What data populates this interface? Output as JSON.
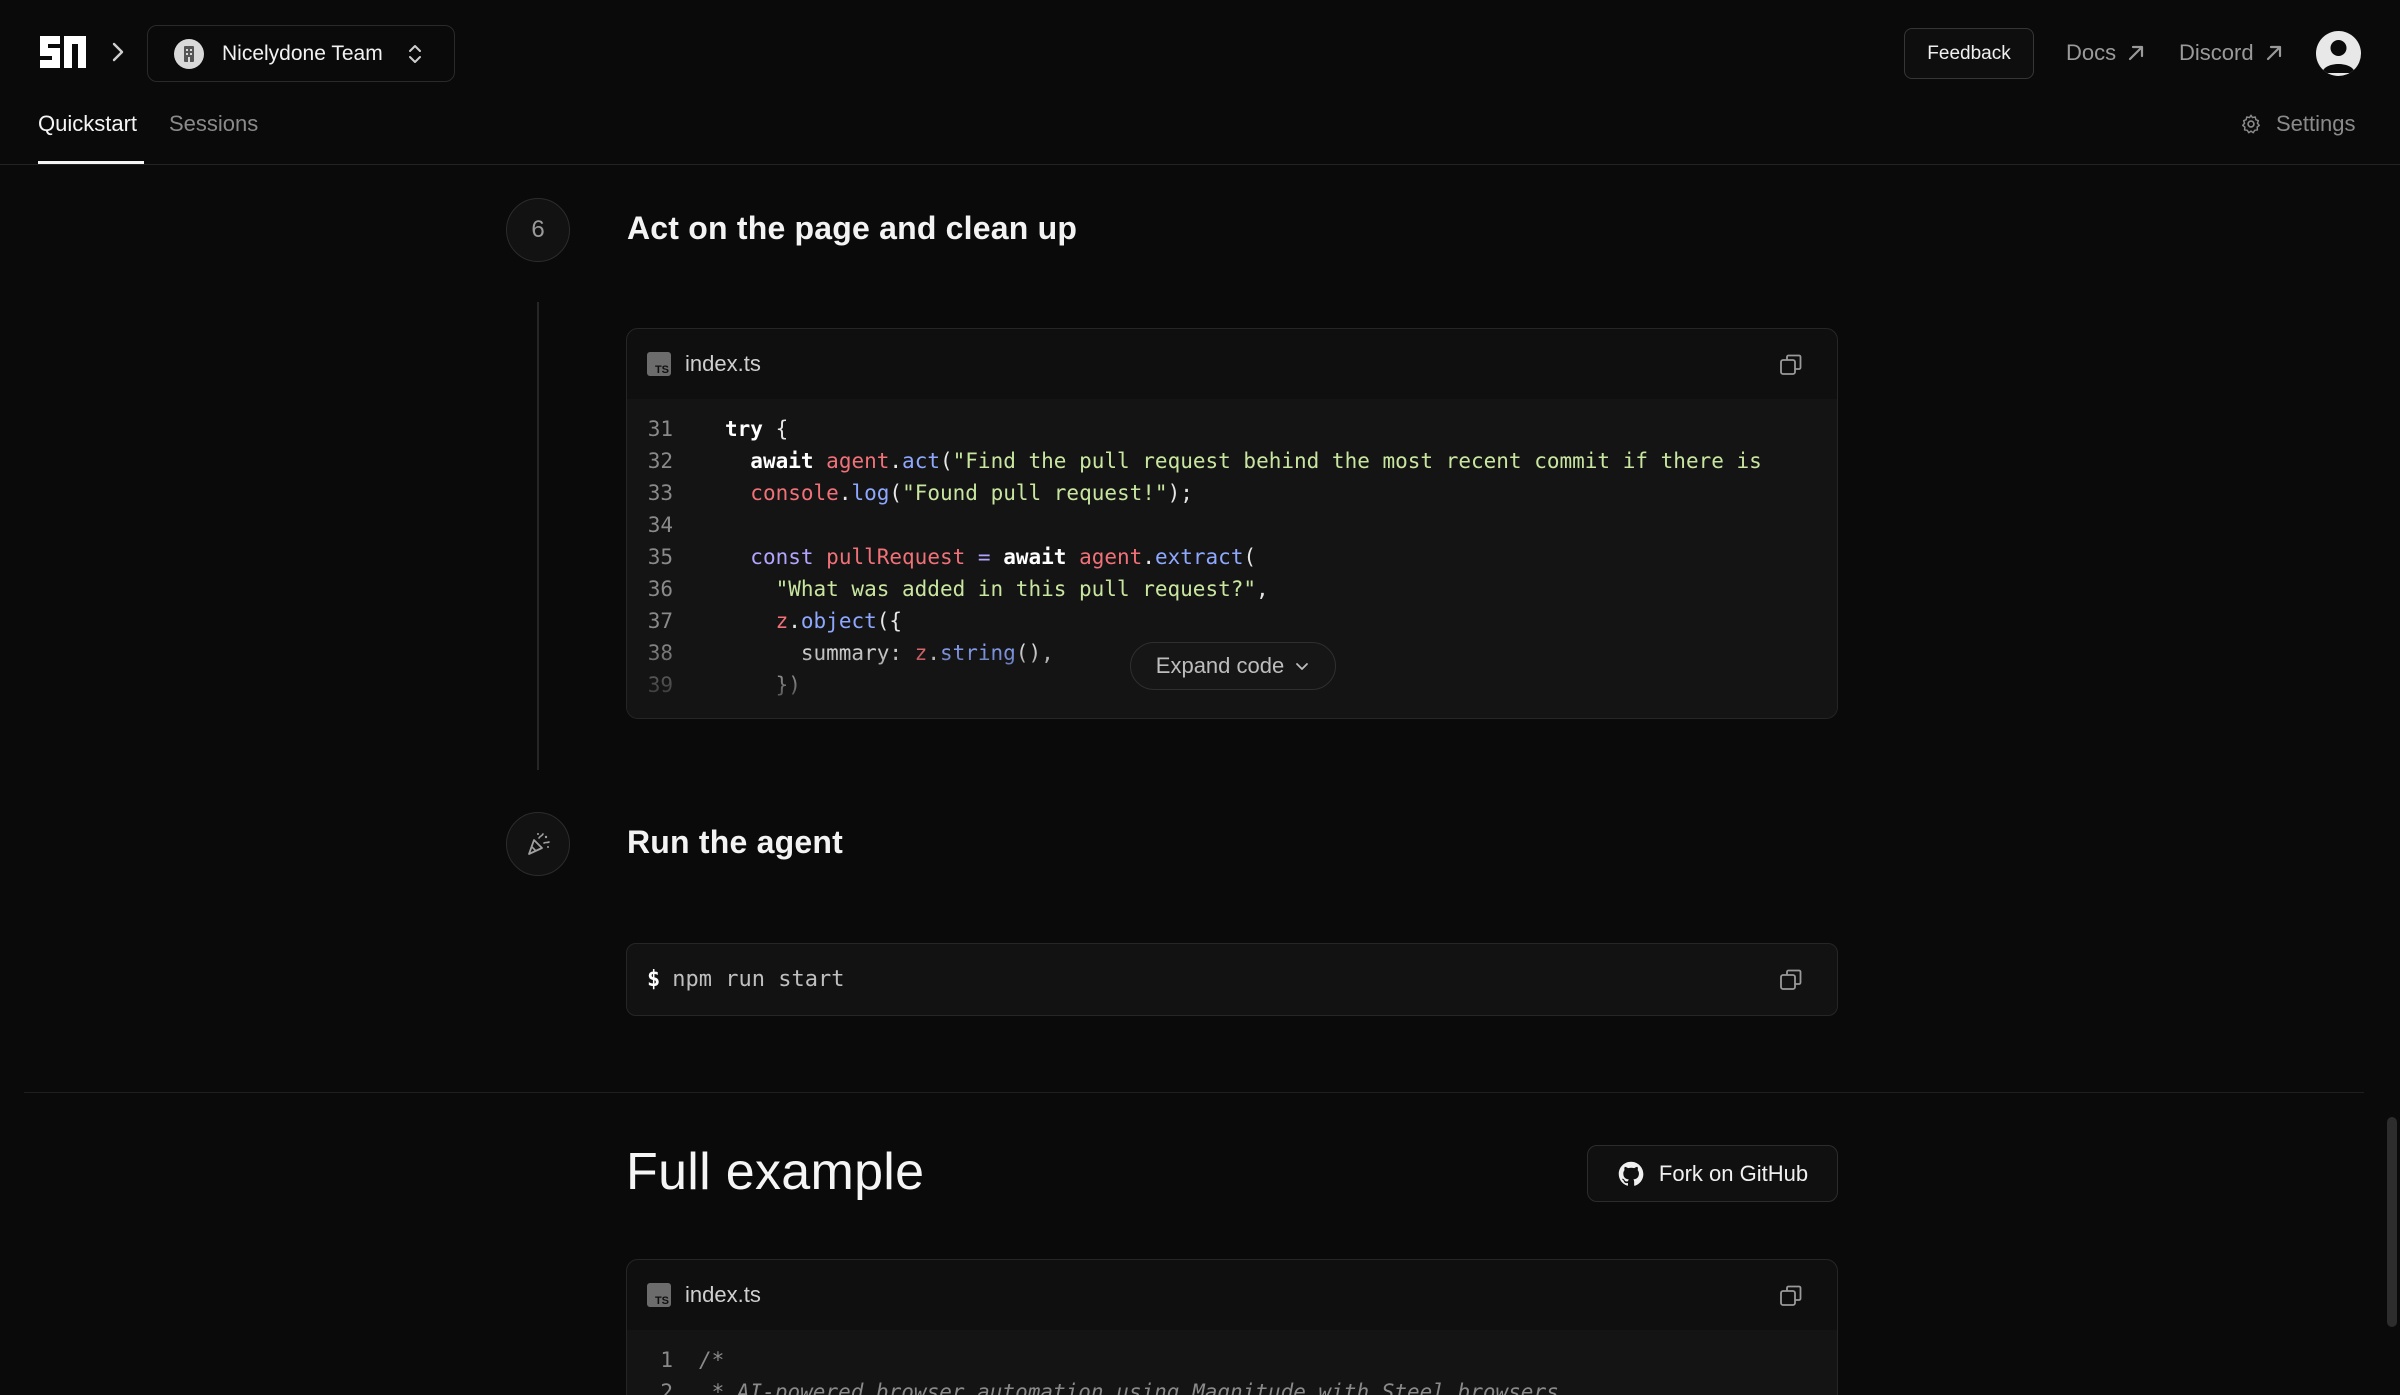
{
  "header": {
    "team_name": "Nicelydone Team",
    "feedback_label": "Feedback",
    "docs_label": "Docs",
    "discord_label": "Discord"
  },
  "tabs": [
    {
      "label": "Quickstart",
      "active": true
    },
    {
      "label": "Sessions",
      "active": false
    }
  ],
  "settings_label": "Settings",
  "step6": {
    "number": "6",
    "title": "Act on the page and clean up",
    "file": "index.ts",
    "expand_label": "Expand code",
    "line_numbers": [
      "31",
      "32",
      "33",
      "34",
      "35",
      "36",
      "37",
      "38",
      "39"
    ]
  },
  "run_step": {
    "title": "Run the agent",
    "prompt": "$",
    "command": "npm run start"
  },
  "full_example": {
    "title": "Full example",
    "fork_label": "Fork on GitHub",
    "file": "index.ts",
    "line_numbers": [
      "1",
      "2"
    ]
  },
  "icons": {
    "logo": "steel-logo",
    "chevron": "chevron-right-icon",
    "team_avatar": "building-icon",
    "updown": "chevrons-up-down-icon",
    "external": "arrow-up-right-icon",
    "settings": "gear-icon",
    "copy": "copy-icon",
    "party": "party-popper-icon",
    "github": "github-icon",
    "file_type": "typescript-file-icon"
  },
  "colors": {
    "background": "#0a0a0a",
    "code_keyword": "#ffffff",
    "code_variable": "#f07178",
    "code_function": "#8fa8ff",
    "code_string": "#c8e6a0"
  }
}
